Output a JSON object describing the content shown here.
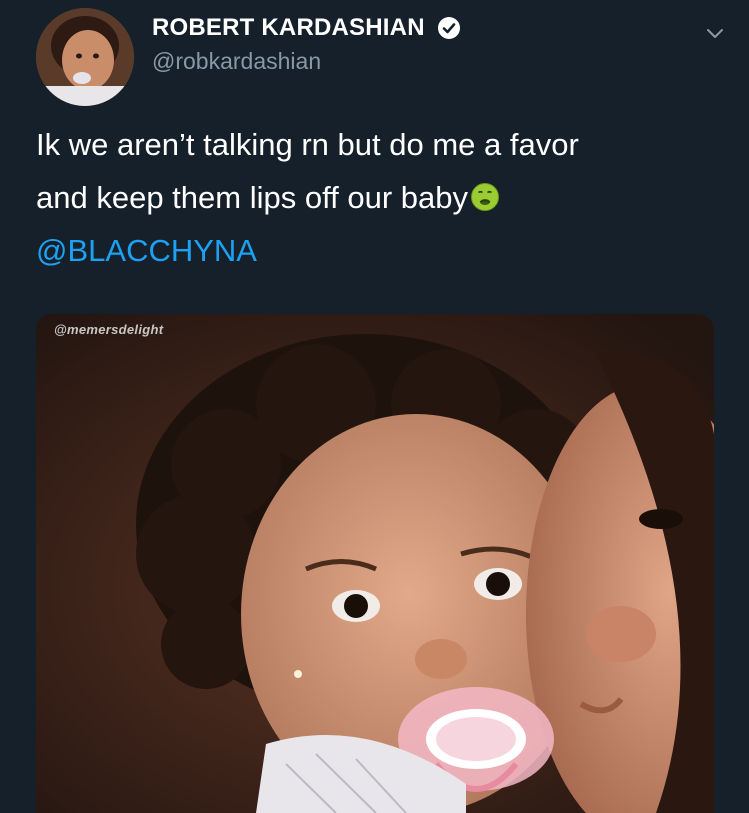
{
  "tweet": {
    "display_name": "ROBERT KARDASHIAN",
    "handle": "@robkardashian",
    "text_line_1": "Ik we aren’t talking rn but do me a favor",
    "text_line_2": "and keep them lips off our baby",
    "mention": "@BLACCHYNA",
    "emoji": "nauseated-face-icon"
  },
  "media": {
    "watermark": "@memersdelight",
    "description_icon": "baby-photo"
  },
  "colors": {
    "background": "#15202b",
    "link": "#1da1f2",
    "verified": "#ffffff",
    "handle": "#8899a6"
  }
}
